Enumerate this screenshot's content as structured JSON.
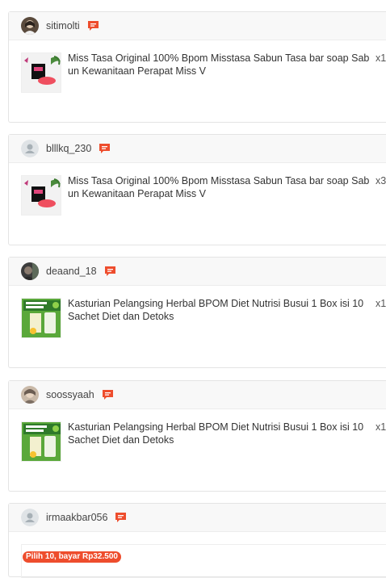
{
  "orders": [
    {
      "username": "sitimolti",
      "product_name": "Miss Tasa Original 100% Bpom Misstasa Sabun Tasa bar soap Sabun Kewanitaan Perapat Miss V",
      "quantity": "x1"
    },
    {
      "username": "blllkq_230",
      "product_name": "Miss Tasa Original 100% Bpom Misstasa Sabun Tasa bar soap Sabun Kewanitaan Perapat Miss V",
      "quantity": "x3"
    },
    {
      "username": "deaand_18",
      "product_name": "Kasturian Pelangsing Herbal BPOM Diet Nutrisi Busui 1 Box isi 10 Sachet Diet dan Detoks",
      "quantity": "x1"
    },
    {
      "username": "soossyaah",
      "product_name": "Kasturian Pelangsing Herbal BPOM Diet Nutrisi Busui 1 Box isi 10 Sachet Diet dan Detoks",
      "quantity": "x1"
    },
    {
      "username": "irmaakbar056"
    }
  ],
  "promo_badge": "Pilih 10, bayar Rp32.500",
  "colors": {
    "accent": "#ee4d2d",
    "header_bg": "#f8f8f8"
  },
  "icons": {
    "chat": "chat-bubble-icon"
  }
}
